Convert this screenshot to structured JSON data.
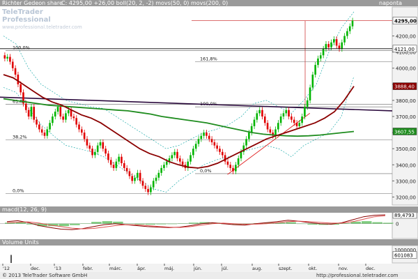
{
  "main_header": {
    "symbol": "Richter Gedeon share",
    "stats": "C: 4295,00 +26,00 boll(20, 2, -2) movs(50, 0) movs(200, 0)",
    "interval": "naponta"
  },
  "logo": {
    "title": "TeleTrader Professional",
    "url": "www.professional.teletrader.com"
  },
  "macd_header": "macd(12, 26, 9)",
  "volume_header": "Volume Units",
  "footer": {
    "copyright": "© 2013 TeleTrader Software GmbH",
    "url": "http://professional.teletrader.com"
  },
  "colors": {
    "up": "#00b400",
    "down": "#e00000",
    "ma50": "#8b0000",
    "ma200": "#1e8c1e",
    "trend": "#2b0a3d",
    "boll": "#00a0a0",
    "fib": "#000000",
    "header": "#9a9a9a",
    "macd": "#8b0000",
    "signal": "#e05050",
    "hist": "#5fbf5f"
  },
  "chart_data": [
    {
      "type": "candlestick",
      "title": "Richter Gedeon share",
      "interval": "naponta",
      "ylim": [
        3150,
        4380
      ],
      "y_ticks": [
        4200,
        4100,
        4000,
        3900,
        3800,
        3700,
        3600,
        3500,
        3400,
        3300,
        3200
      ],
      "y_tick_labels": [
        "4200,00",
        "4100,00",
        "4000,00",
        "3900,00",
        "3800,00",
        "3700,00",
        "3600,00",
        "3500,00",
        "3400,00",
        "3300,00",
        "3200,00"
      ],
      "x_labels": [
        "'12",
        "dec.",
        "'13",
        "febr.",
        "márc.",
        "ápr.",
        "máj.",
        "jún.",
        "júl.",
        "aug.",
        "szept.",
        "okt.",
        "nov.",
        "dec."
      ],
      "last_close": "4295,00",
      "price_tags": [
        {
          "value": 4295,
          "text": "4295,00",
          "kind": "last"
        },
        {
          "value": 4121,
          "text": "4121,00",
          "kind": "level"
        },
        {
          "value": 3888,
          "text": "3888,40",
          "kind": "ma50"
        },
        {
          "value": 3607,
          "text": "3607,55",
          "kind": "ma200"
        }
      ],
      "fib_levels": [
        {
          "label": "100,0%",
          "value": 4110,
          "segment": "left"
        },
        {
          "label": "61,8%",
          "value": 3775,
          "segment": "left"
        },
        {
          "label": "38,2%",
          "value": 3555,
          "segment": "left"
        },
        {
          "label": "0,0%",
          "value": 3222,
          "segment": "left"
        },
        {
          "label": "161,8%",
          "value": 4040,
          "segment": "right"
        },
        {
          "label": "100,0%",
          "value": 3760,
          "segment": "right"
        },
        {
          "label": "0,0%",
          "value": 3345,
          "segment": "right"
        }
      ],
      "series": [
        {
          "name": "price",
          "kind": "ohlc",
          "closes": [
            4060,
            4070,
            4040,
            4000,
            3960,
            3900,
            3850,
            3780,
            3740,
            3700,
            3760,
            3680,
            3650,
            3620,
            3600,
            3580,
            3620,
            3660,
            3700,
            3730,
            3760,
            3700,
            3680,
            3720,
            3740,
            3700,
            3690,
            3650,
            3620,
            3600,
            3560,
            3520,
            3500,
            3460,
            3480,
            3520,
            3540,
            3500,
            3470,
            3430,
            3400,
            3380,
            3420,
            3450,
            3410,
            3380,
            3360,
            3330,
            3300,
            3320,
            3350,
            3300,
            3270,
            3250,
            3230,
            3260,
            3300,
            3320,
            3350,
            3380,
            3400,
            3420,
            3440,
            3460,
            3480,
            3440,
            3420,
            3400,
            3380,
            3420,
            3460,
            3500,
            3530,
            3560,
            3580,
            3600,
            3580,
            3560,
            3540,
            3520,
            3500,
            3480,
            3460,
            3420,
            3400,
            3380,
            3360,
            3400,
            3440,
            3480,
            3520,
            3560,
            3600,
            3640,
            3680,
            3720,
            3740,
            3700,
            3660,
            3620,
            3600,
            3580,
            3620,
            3660,
            3700,
            3720,
            3740,
            3700,
            3680,
            3660,
            3640,
            3660,
            3700,
            3760,
            3800,
            3880,
            3960,
            4020,
            4060,
            4080,
            4120,
            4150,
            4130,
            4160,
            4180,
            4140,
            4120,
            4160,
            4200,
            4230,
            4260,
            4295
          ]
        },
        {
          "name": "movs(50, 0)",
          "values": [
            3960,
            3940,
            3900,
            3860,
            3820,
            3790,
            3770,
            3740,
            3710,
            3690,
            3660,
            3620,
            3580,
            3540,
            3500,
            3470,
            3450,
            3420,
            3400,
            3385,
            3380,
            3390,
            3410,
            3440,
            3470,
            3500,
            3530,
            3560,
            3580,
            3600,
            3620,
            3640,
            3660,
            3690,
            3730,
            3800,
            3888
          ]
        },
        {
          "name": "movs(200, 0)",
          "values": [
            3810,
            3800,
            3790,
            3780,
            3770,
            3765,
            3760,
            3755,
            3750,
            3745,
            3740,
            3735,
            3725,
            3715,
            3700,
            3690,
            3680,
            3670,
            3660,
            3645,
            3630,
            3615,
            3600,
            3590,
            3585,
            3580,
            3578,
            3580,
            3585,
            3592,
            3600,
            3607
          ]
        },
        {
          "name": "boll upper",
          "values": [
            4200,
            4150,
            4000,
            3900,
            3850,
            3800,
            3780,
            3760,
            3750,
            3700,
            3650,
            3600,
            3550,
            3500,
            3520,
            3560,
            3600,
            3620,
            3650,
            3700,
            3780,
            3800,
            3760,
            3720,
            3800,
            3900,
            4100,
            4250,
            4350
          ]
        },
        {
          "name": "boll lower",
          "values": [
            3880,
            3850,
            3750,
            3650,
            3580,
            3520,
            3500,
            3480,
            3450,
            3400,
            3350,
            3300,
            3250,
            3230,
            3300,
            3350,
            3400,
            3430,
            3450,
            3480,
            3500,
            3520,
            3500,
            3450,
            3520,
            3560,
            3600,
            3700,
            3950
          ]
        }
      ],
      "trendlines": [
        {
          "from": [
            0,
            3820
          ],
          "to": [
            1,
            3735
          ],
          "name": "resistance"
        },
        {
          "from": [
            0.58,
            3340
          ],
          "to": [
            0.79,
            3720
          ],
          "name": "support"
        }
      ]
    },
    {
      "type": "line",
      "title": "macd(12, 26, 9)",
      "ylim": [
        -150,
        110
      ],
      "y_ticks": [
        0
      ],
      "y_tick_labels": [
        "0"
      ],
      "value_tag": "89,4793",
      "series": [
        {
          "name": "macd",
          "values": [
            20,
            30,
            10,
            -20,
            -40,
            -55,
            -60,
            -50,
            -30,
            -10,
            0,
            -10,
            -20,
            -30,
            -35,
            -40,
            -35,
            -20,
            0,
            10,
            0,
            -10,
            -15,
            0,
            10,
            20,
            35,
            25,
            10,
            0,
            -5,
            10,
            40,
            70,
            85,
            89
          ]
        },
        {
          "name": "signal",
          "values": [
            10,
            15,
            18,
            5,
            -15,
            -30,
            -45,
            -52,
            -48,
            -35,
            -20,
            -10,
            -12,
            -20,
            -28,
            -35,
            -38,
            -30,
            -15,
            0,
            5,
            0,
            -5,
            -5,
            0,
            10,
            20,
            25,
            20,
            12,
            5,
            5,
            20,
            45,
            70,
            80
          ]
        }
      ]
    },
    {
      "type": "bar",
      "title": "Volume Units",
      "ylim": [
        0,
        1300000
      ],
      "y_ticks": [
        1000000
      ],
      "y_tick_labels": [
        "1000000"
      ],
      "value_tag": "601083",
      "values": [
        600000
      ]
    }
  ]
}
